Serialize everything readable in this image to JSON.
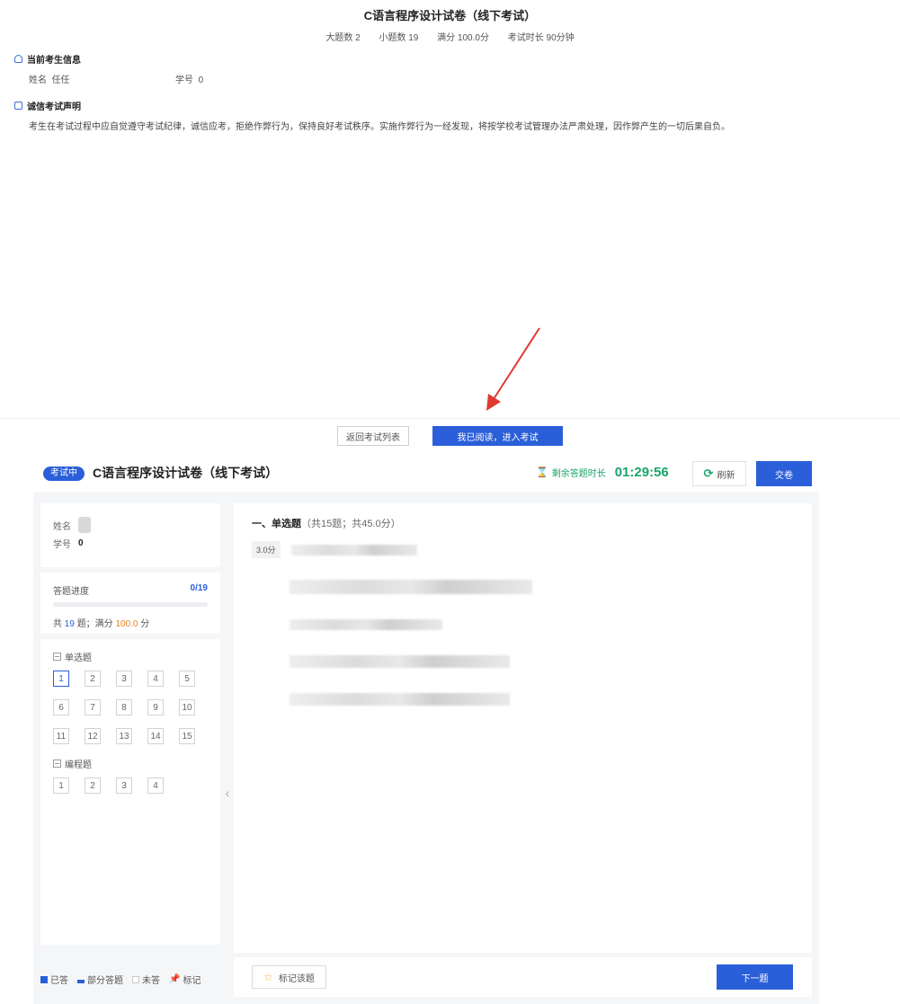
{
  "notice_page": {
    "title": "C语言程序设计试卷（线下考试）",
    "meta": {
      "big_q_label": "大题数",
      "big_q": "2",
      "small_q_label": "小题数",
      "small_q": "19",
      "full_score_label": "满分",
      "full_score": "100.0分",
      "duration_label": "考试时长",
      "duration": "90分钟"
    },
    "candidate_section": "当前考生信息",
    "name_label": "姓名",
    "name_value": "任任",
    "id_label": "学号",
    "id_value": "0",
    "integrity_section": "诚信考试声明",
    "integrity_text": "考生在考试过程中应自觉遵守考试纪律，诚信应考，拒绝作弊行为，保持良好考试秩序。实施作弊行为一经发现，将按学校考试管理办法严肃处理，因作弊产生的一切后果自负。",
    "back_button": "返回考试列表",
    "enter_button": "我已阅读，进入考试"
  },
  "exam": {
    "status": "考试中",
    "title": "C语言程序设计试卷（线下考试）",
    "timer_label": "剩余答题时长",
    "timer_value": "01:29:56",
    "refresh_label": "刷新",
    "submit_label": "交卷",
    "sidebar": {
      "name_label": "姓名",
      "id_label": "学号",
      "id_value": "0",
      "progress_label": "答题进度",
      "progress_count": "0/19",
      "progress_fraction": 0,
      "totals_prefix": "共",
      "totals_count": "19",
      "totals_mid": "题；满分",
      "totals_score": "100.0",
      "totals_suffix": "分",
      "groups": [
        {
          "label": "单选题",
          "numbers": [
            "1",
            "2",
            "3",
            "4",
            "5",
            "6",
            "7",
            "8",
            "9",
            "10",
            "11",
            "12",
            "13",
            "14",
            "15"
          ],
          "current": "1"
        },
        {
          "label": "编程题",
          "numbers": [
            "1",
            "2",
            "3",
            "4"
          ]
        }
      ],
      "collapse_icon": "chevron-left-icon"
    },
    "legend": {
      "answered": "已答",
      "partial": "部分答题",
      "unanswered": "未答",
      "marked": "标记"
    },
    "question": {
      "section_title": "一、单选题",
      "section_sub": "（共15题；共45.0分）",
      "score": "3.0分"
    },
    "mark_button": "标记该题",
    "next_button": "下一题"
  },
  "colors": {
    "primary": "#2b5fd9",
    "timer_green": "#1aa36a",
    "accent_orange": "#e28228",
    "arrow_red": "#e03a32"
  }
}
